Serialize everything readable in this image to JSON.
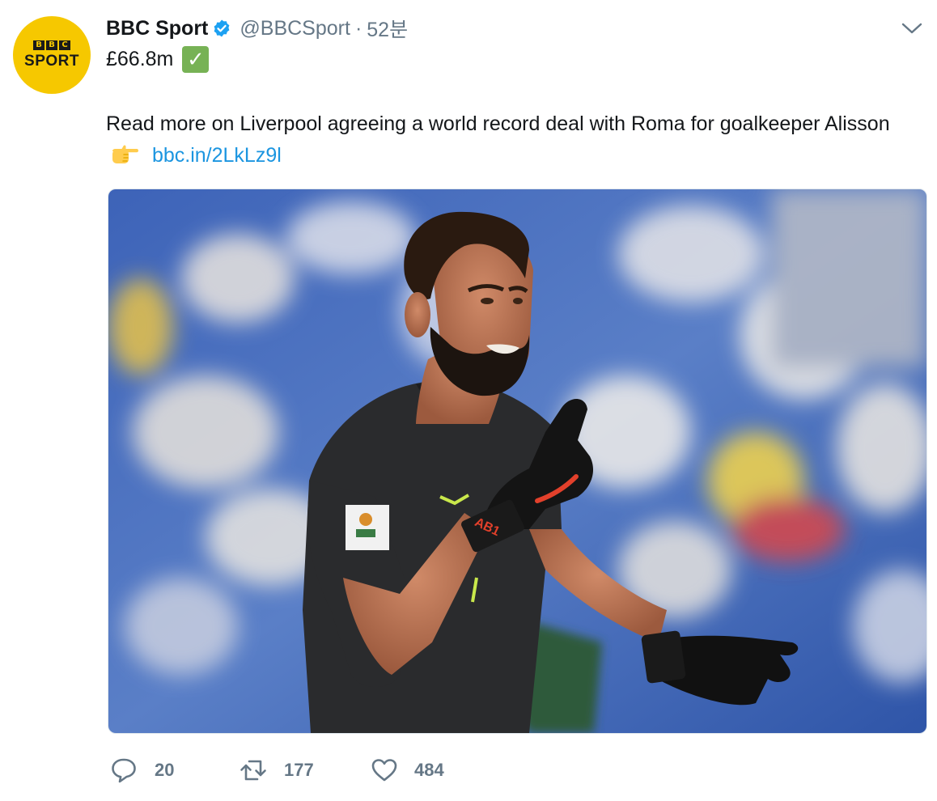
{
  "account": {
    "display_name": "BBC Sport",
    "handle": "@BBCSport",
    "separator": "·",
    "time": "52분",
    "avatar_blocks": [
      "B",
      "B",
      "C"
    ],
    "avatar_word": "SPORT"
  },
  "tweet": {
    "line1": "£66.8m",
    "line1_emoji": "✅",
    "body": "Read more on Liverpool agreeing a world record deal with Roma for goalkeeper Alisson",
    "body_emoji": "point-right-icon",
    "link": "bbc.in/2LkLz9l"
  },
  "image": {
    "description_icon": "photo",
    "glove_text": "AB1"
  },
  "actions": {
    "replies": "20",
    "retweets": "177",
    "likes": "484"
  },
  "colors": {
    "link": "#1b95e0",
    "muted": "#657786",
    "verified": "#1da1f2",
    "avatar_bg": "#f6c800"
  }
}
